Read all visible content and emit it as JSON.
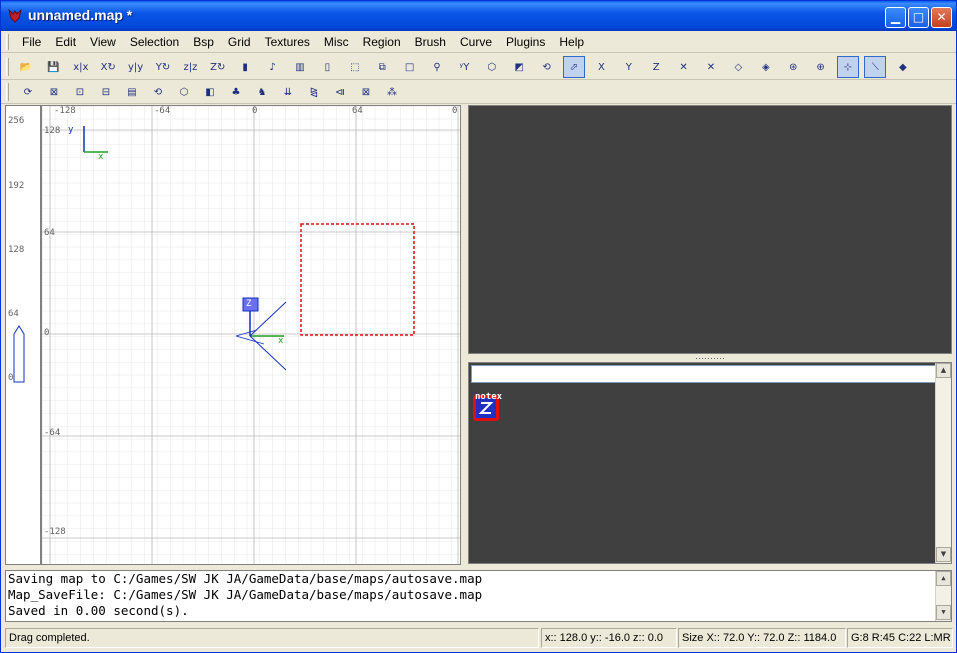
{
  "window": {
    "title": "unnamed.map *"
  },
  "menu": [
    "File",
    "Edit",
    "View",
    "Selection",
    "Bsp",
    "Grid",
    "Textures",
    "Misc",
    "Region",
    "Brush",
    "Curve",
    "Plugins",
    "Help"
  ],
  "toolbar1": [
    {
      "name": "open-icon",
      "glyph": "📂"
    },
    {
      "name": "save-icon",
      "glyph": "💾"
    },
    {
      "name": "flip-x-button",
      "glyph": "x|x"
    },
    {
      "name": "rotate-x-button",
      "glyph": "X↻"
    },
    {
      "name": "flip-y-button",
      "glyph": "y|y"
    },
    {
      "name": "rotate-y-button",
      "glyph": "Y↻"
    },
    {
      "name": "flip-z-button",
      "glyph": "z|z"
    },
    {
      "name": "rotate-z-button",
      "glyph": "Z↻"
    },
    {
      "name": "select-complete-tall-button",
      "glyph": "▮"
    },
    {
      "name": "select-touching-button",
      "glyph": "♪"
    },
    {
      "name": "select-partial-tall-button",
      "glyph": "▥"
    },
    {
      "name": "select-inside-button",
      "glyph": "▯"
    },
    {
      "name": "csg-subtract-button",
      "glyph": "⬚"
    },
    {
      "name": "csg-merge-button",
      "glyph": "⧉"
    },
    {
      "name": "make-hollow-button",
      "glyph": "□"
    },
    {
      "name": "clipper-button",
      "glyph": "⚲"
    },
    {
      "name": "texture-lock-button",
      "glyph": "ʸY"
    },
    {
      "name": "change-views-button",
      "glyph": "⬡"
    },
    {
      "name": "cubic-clip-button",
      "glyph": "◩"
    },
    {
      "name": "camera-button",
      "glyph": "⟲"
    },
    {
      "name": "view-3d-button",
      "glyph": "⬀"
    },
    {
      "name": "view-x-button",
      "glyph": "X"
    },
    {
      "name": "view-y-button",
      "glyph": "Y"
    },
    {
      "name": "view-z-button",
      "glyph": "Z"
    },
    {
      "name": "patch-mode-button",
      "glyph": "✕"
    },
    {
      "name": "curve-mode-button",
      "glyph": "✕"
    },
    {
      "name": "show-entities-button",
      "glyph": "◇"
    },
    {
      "name": "patch-bend-button",
      "glyph": "◈"
    },
    {
      "name": "patch-insert-button",
      "glyph": "⊛"
    },
    {
      "name": "patch-tesselate-button",
      "glyph": "⊕"
    },
    {
      "name": "drag-edges-button",
      "glyph": "⊹"
    },
    {
      "name": "drag-vertices-button",
      "glyph": "⟍"
    },
    {
      "name": "scale-button",
      "glyph": "◆"
    }
  ],
  "toolbar2": [
    {
      "name": "rotate-icon",
      "glyph": "⟳"
    },
    {
      "name": "bend-icon",
      "glyph": "⊠"
    },
    {
      "name": "bend-alt-icon",
      "glyph": "⊡"
    },
    {
      "name": "bend-z-icon",
      "glyph": "⊟"
    },
    {
      "name": "clip-icon",
      "glyph": "▤"
    },
    {
      "name": "refresh-icon",
      "glyph": "⟲"
    },
    {
      "name": "hexagon-icon",
      "glyph": "⬡"
    },
    {
      "name": "shader-icon",
      "glyph": "◧"
    },
    {
      "name": "tree-icon",
      "glyph": "♣"
    },
    {
      "name": "monster-icon",
      "glyph": "♞"
    },
    {
      "name": "push-icon",
      "glyph": "⇊"
    },
    {
      "name": "flip-horizontal-icon",
      "glyph": "⧎"
    },
    {
      "name": "flip-vertical-icon",
      "glyph": "⧏"
    },
    {
      "name": "fit-icon",
      "glyph": "⊠"
    },
    {
      "name": "pattern-icon",
      "glyph": "⁂"
    }
  ],
  "grid": {
    "top_ticks": [
      "-128",
      "-64",
      "0",
      "64",
      "0"
    ],
    "left_ticks": [
      "256",
      "192",
      "128",
      "64",
      "0"
    ],
    "inner_ticks": [
      "128",
      "64",
      "0",
      "-64",
      "-128",
      "-128"
    ],
    "axis_x_label": "x",
    "axis_y_label": "y",
    "entity_label": "Z",
    "dotted_brush": true
  },
  "texture_panel": {
    "filter_value": "",
    "items": [
      {
        "label": "notex"
      }
    ]
  },
  "console": [
    "Saving map to C:/Games/SW JK JA/GameData/base/maps/autosave.map",
    "Map_SaveFile: C:/Games/SW JK JA/GameData/base/maps/autosave.map",
    "Saved in 0.00 second(s)."
  ],
  "status": {
    "message": "Drag completed.",
    "position": "x:: 128.0  y:: -16.0  z:: 0.0",
    "size": "Size X:: 72.0  Y:: 72.0  Z:: 1184.0",
    "grid": "G:8 R:45 C:22 L:MR"
  },
  "colors": {
    "titlebar": "#0346d8",
    "camera_bg": "#404040",
    "brush": "#e01010",
    "axis_blue": "#1030c0",
    "axis_green": "#20a020"
  }
}
